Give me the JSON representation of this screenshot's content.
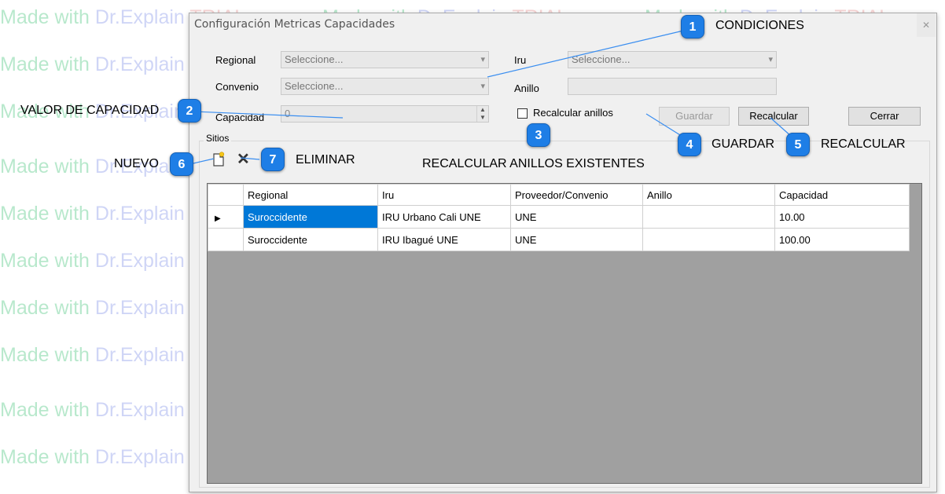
{
  "watermark": {
    "made_with": "Made with ",
    "brand": "Dr.Explain ",
    "trial": "TRIAL"
  },
  "window": {
    "title": "Configuración Metricas Capacidades",
    "close_glyph": "✕"
  },
  "form": {
    "regional_label": "Regional",
    "regional_value": "Seleccione...",
    "iru_label": "Iru",
    "iru_value": "Seleccione...",
    "convenio_label": "Convenio",
    "convenio_value": "Seleccione...",
    "anillo_label": "Anillo",
    "anillo_value": "",
    "capacidad_label": "Capacidad",
    "capacidad_value": "0",
    "recalcular_anillos_label": "Recalcular anillos",
    "recalcular_anillos_checked": false
  },
  "buttons": {
    "guardar": "Guardar",
    "recalcular": "Recalcular",
    "cerrar": "Cerrar"
  },
  "sitios": {
    "title": "Sitios",
    "toolbar": {
      "new_icon": "new-document-icon",
      "delete_icon": "delete-x-icon"
    },
    "columns": [
      "Regional",
      "Iru",
      "Proveedor/Convenio",
      "Anillo",
      "Capacidad"
    ],
    "rows": [
      {
        "regional": "Suroccidente",
        "iru": "IRU Urbano Cali UNE",
        "proveedor": "UNE",
        "anillo": "",
        "capacidad": "10.00",
        "current": true
      },
      {
        "regional": "Suroccidente",
        "iru": "IRU Ibagué UNE",
        "proveedor": "UNE",
        "anillo": "",
        "capacidad": "100.00",
        "current": false
      }
    ]
  },
  "annotations": [
    {
      "number": "1",
      "text": "CONDICIONES"
    },
    {
      "number": "2",
      "text": "VALOR DE CAPACIDAD"
    },
    {
      "number": "3",
      "text": "RECALCULAR ANILLOS EXISTENTES"
    },
    {
      "number": "4",
      "text": "GUARDAR"
    },
    {
      "number": "5",
      "text": "RECALCULAR"
    },
    {
      "number": "6",
      "text": "NUEVO"
    },
    {
      "number": "7",
      "text": "ELIMINAR"
    }
  ],
  "colors": {
    "callout": "#1e7ee6",
    "selection": "#0078d7",
    "grid_background": "#a0a0a0"
  }
}
